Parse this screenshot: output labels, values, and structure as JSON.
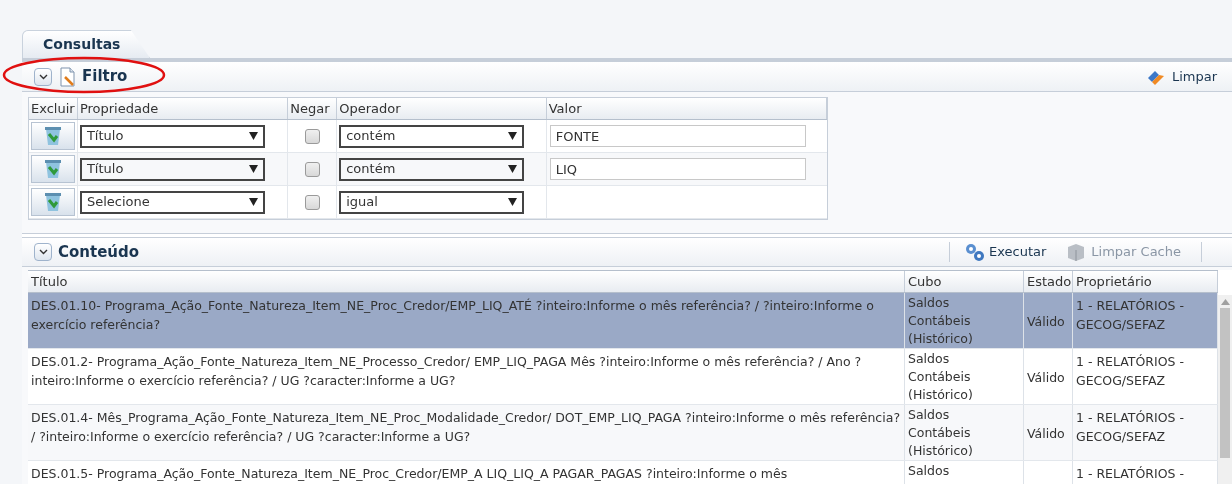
{
  "tab": {
    "label": "Consultas",
    "selected": true
  },
  "filter": {
    "title": "Filtro",
    "expanded": true,
    "clear_button": "Limpar",
    "columns": [
      "Excluir",
      "Propriedade",
      "Negar",
      "Operador",
      "Valor"
    ],
    "rows": [
      {
        "property": "Título",
        "negate": false,
        "operator": "contém",
        "value": "FONTE"
      },
      {
        "property": "Título",
        "negate": false,
        "operator": "contém",
        "value": "LIQ"
      },
      {
        "property": "Selecione",
        "negate": false,
        "operator": "igual"
      }
    ]
  },
  "content": {
    "title": "Conteúdo",
    "expanded": true,
    "toolbar": [
      {
        "label": "Executar",
        "disabled": false
      },
      {
        "label": "Limpar Cache",
        "disabled": true
      }
    ],
    "columns": [
      "Título",
      "Cubo",
      "Estado",
      "Proprietário"
    ],
    "rows": [
      {
        "selected": true,
        "title": "DES.01.10- Programa_Ação_Fonte_Natureza_Item_NE_Proc_Credor/EMP_LIQ_ATÉ ?inteiro:Informe o mês referência? / ?inteiro:Informe o exercício referência?",
        "cube": "Saldos Contábeis (Histórico)",
        "state": "Válido",
        "owner": "1 - RELATÓRIOS - GECOG/SEFAZ"
      },
      {
        "selected": false,
        "title": "DES.01.2- Programa_Ação_Fonte_Natureza_Item_NE_Processo_Credor/ EMP_LIQ_PAGA Mês ?inteiro:Informe o mês referência? / Ano ?inteiro:Informe o exercício referência? / UG ?caracter:Informe a UG?",
        "cube": "Saldos Contábeis (Histórico)",
        "state": "Válido",
        "owner": "1 - RELATÓRIOS - GECOG/SEFAZ"
      },
      {
        "selected": false,
        "title": "DES.01.4- Mês_Programa_Ação_Fonte_Natureza_Item_NE_Proc_Modalidade_Credor/ DOT_EMP_LIQ_PAGA ?inteiro:Informe o mês referência? / ?inteiro:Informe o exercício referência? / UG ?caracter:Informe a UG?",
        "cube": "Saldos Contábeis (Histórico)",
        "state": "Válido",
        "owner": "1 - RELATÓRIOS - GECOG/SEFAZ"
      },
      {
        "selected": false,
        "title": "DES.01.5- Programa_Ação_Fonte_Natureza_Item_NE_Proc_Credor/EMP_A LIQ_LIQ_A PAGAR_PAGAS ?inteiro:Informe o mês",
        "cube": "Saldos",
        "owner": "1 - RELATÓRIOS -"
      }
    ]
  }
}
